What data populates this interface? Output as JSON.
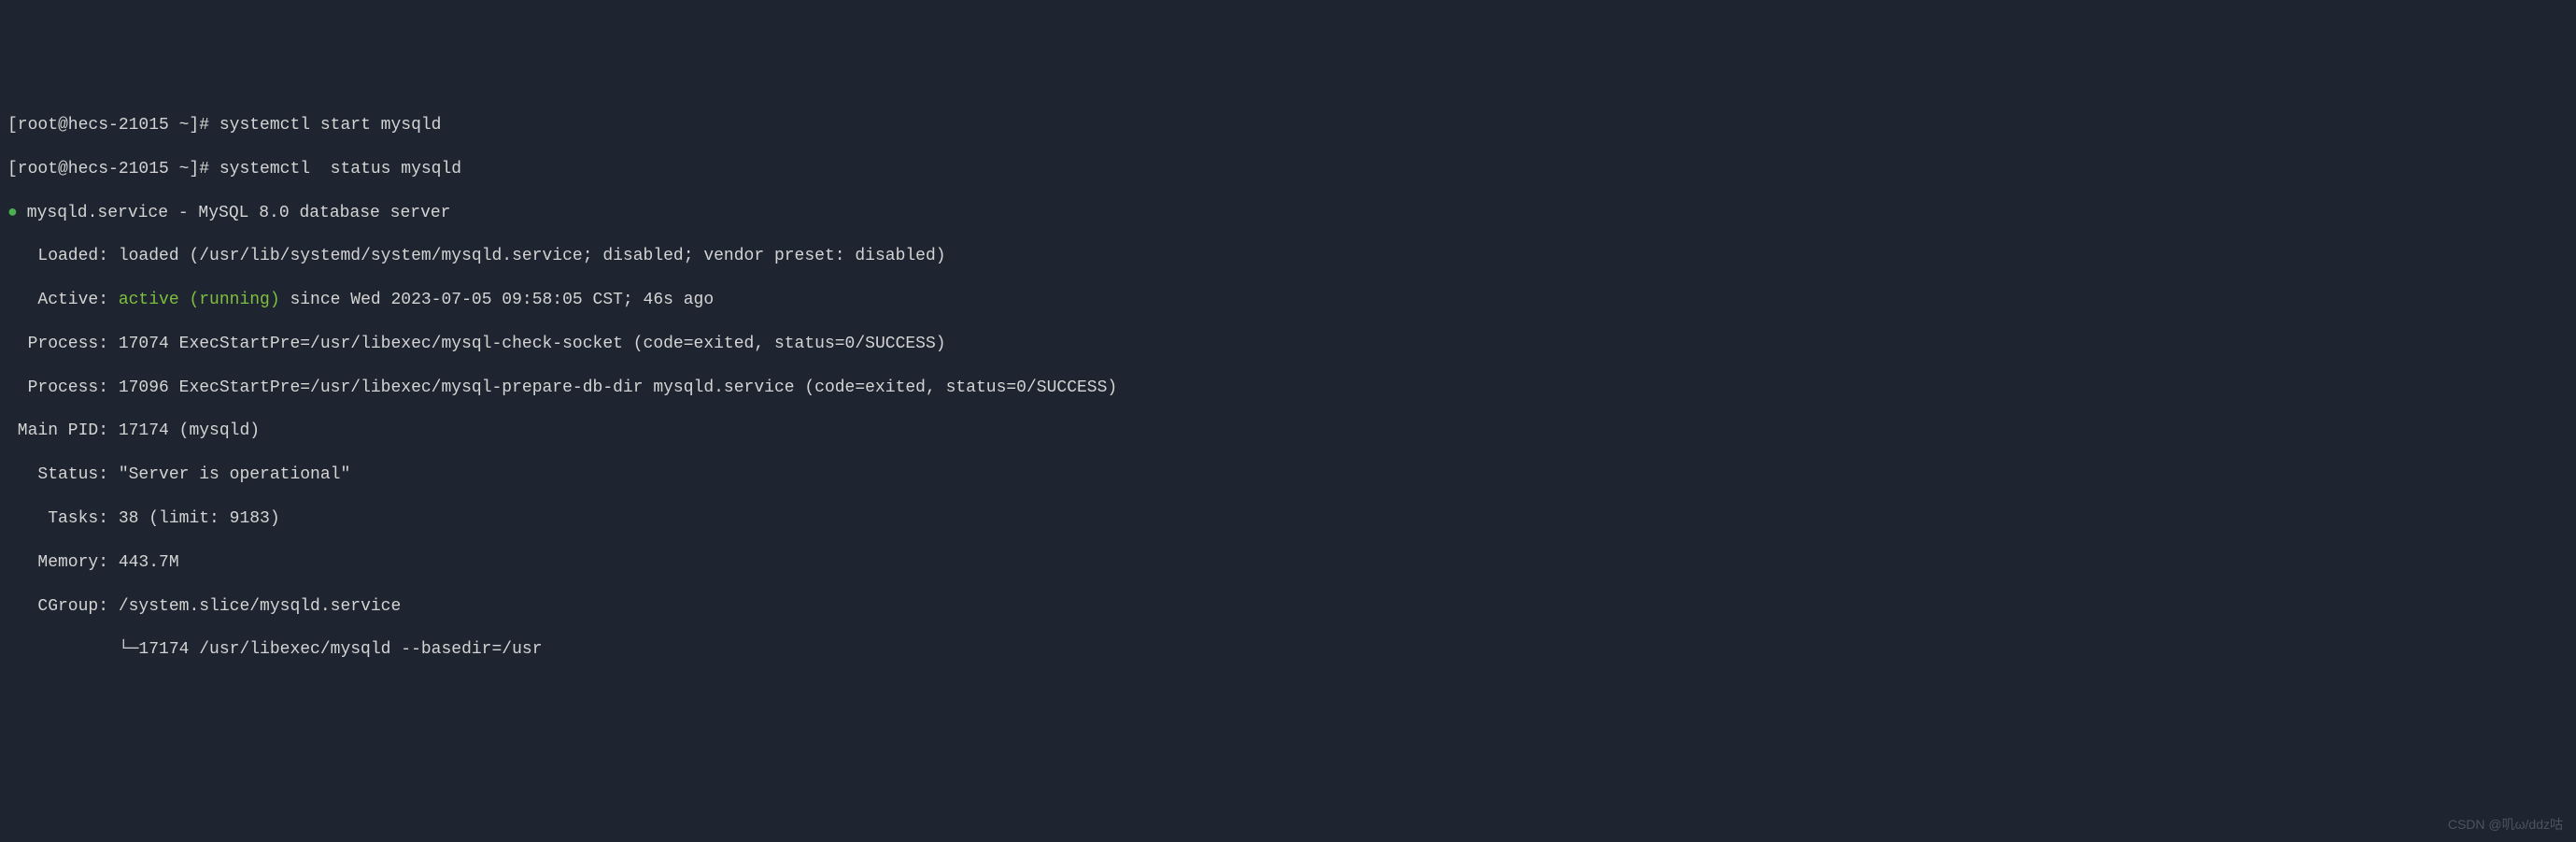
{
  "prompts": {
    "line1_prompt": "[root@hecs-21015 ~]#",
    "line1_cmd": " systemctl start mysqld",
    "line2_prompt": "[root@hecs-21015 ~]#",
    "line2_cmd": " systemctl  status mysqld"
  },
  "service": {
    "bullet": "●",
    "header": " mysqld.service - MySQL 8.0 database server",
    "loaded_label": "   Loaded: ",
    "loaded_value": "loaded (/usr/lib/systemd/system/mysqld.service; disabled; vendor preset: disabled)",
    "active_label": "   Active: ",
    "active_state": "active (running)",
    "active_rest": " since Wed 2023-07-05 09:58:05 CST; 46s ago",
    "process1_label": "  Process: ",
    "process1_value": "17074 ExecStartPre=/usr/libexec/mysql-check-socket (code=exited, status=0/SUCCESS)",
    "process2_label": "  Process: ",
    "process2_value": "17096 ExecStartPre=/usr/libexec/mysql-prepare-db-dir mysqld.service (code=exited, status=0/SUCCESS)",
    "mainpid_label": " Main PID: ",
    "mainpid_value": "17174 (mysqld)",
    "status_label": "   Status: ",
    "status_value": "\"Server is operational\"",
    "tasks_label": "    Tasks: ",
    "tasks_value": "38 (limit: 9183)",
    "memory_label": "   Memory: ",
    "memory_value": "443.7M",
    "cgroup_label": "   CGroup: ",
    "cgroup_value": "/system.slice/mysqld.service",
    "cgroup_child": "           └─17174 /usr/libexec/mysqld --basedir=/usr"
  },
  "watermark": "CSDN @叽ω/ddz咕"
}
